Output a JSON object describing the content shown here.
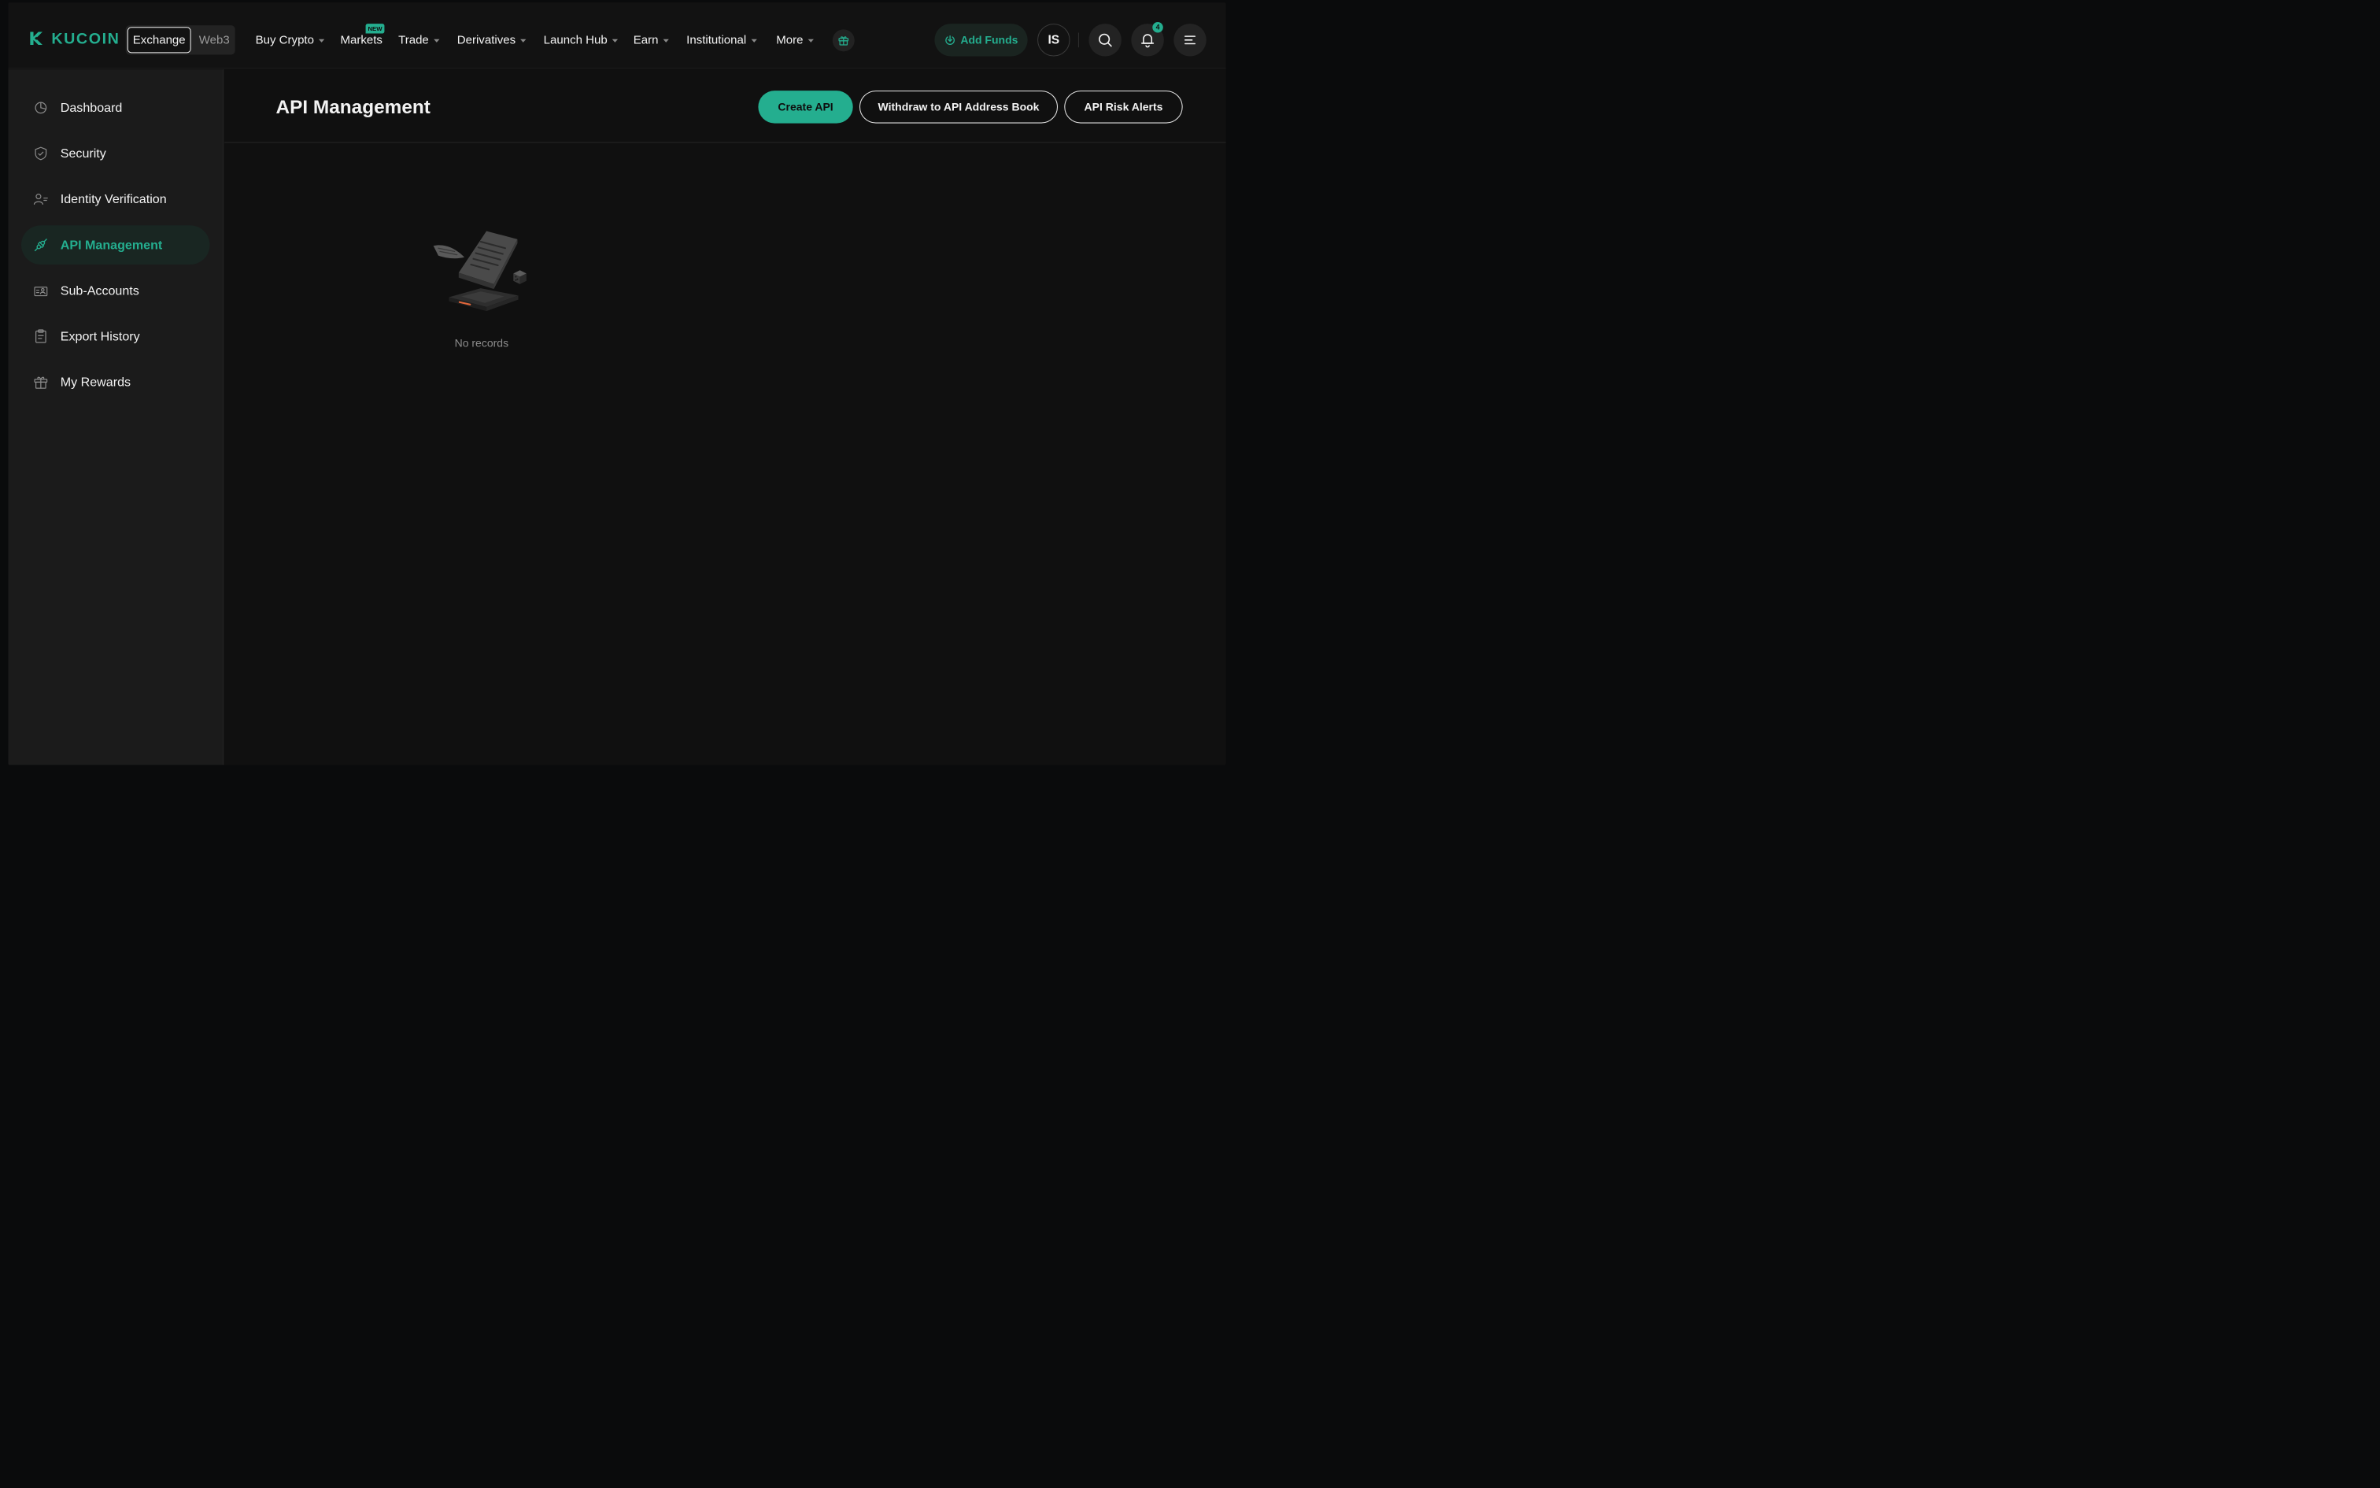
{
  "brand": {
    "logo_text": "KUCOIN"
  },
  "top_nav": {
    "mode_switch": {
      "exchange": "Exchange",
      "web3": "Web3"
    },
    "items": [
      {
        "label": "Buy Crypto",
        "has_dropdown": true
      },
      {
        "label": "Markets",
        "has_dropdown": false,
        "badge": "NEW"
      },
      {
        "label": "Trade",
        "has_dropdown": true
      },
      {
        "label": "Derivatives",
        "has_dropdown": true
      },
      {
        "label": "Launch Hub",
        "has_dropdown": true
      },
      {
        "label": "Earn",
        "has_dropdown": true
      },
      {
        "label": "Institutional",
        "has_dropdown": true
      },
      {
        "label": "More",
        "has_dropdown": true
      }
    ],
    "gift_icon": "gift-icon",
    "add_funds_label": "Add Funds",
    "avatar_initials": "IS",
    "search_icon": "search-icon",
    "bell_icon": "bell-icon",
    "notification_count": "4",
    "menu_icon": "menu-icon"
  },
  "sidebar": {
    "items": [
      {
        "label": "Dashboard",
        "icon": "pie-chart-icon",
        "active": false
      },
      {
        "label": "Security",
        "icon": "shield-check-icon",
        "active": false
      },
      {
        "label": "Identity Verification",
        "icon": "user-id-icon",
        "active": false
      },
      {
        "label": "API Management",
        "icon": "plug-icon",
        "active": true
      },
      {
        "label": "Sub-Accounts",
        "icon": "sub-accounts-icon",
        "active": false
      },
      {
        "label": "Export History",
        "icon": "clipboard-icon",
        "active": false
      },
      {
        "label": "My Rewards",
        "icon": "gift-icon",
        "active": false
      }
    ]
  },
  "main": {
    "title": "API Management",
    "buttons": {
      "create_api": "Create API",
      "withdraw_address_book": "Withdraw to API Address Book",
      "risk_alerts": "API Risk Alerts"
    },
    "empty_state": {
      "text": "No records",
      "illustration": "empty-records-illustration"
    }
  },
  "colors": {
    "accent": "#24ae8f",
    "background": "#101010",
    "sidebar": "#1b1b1b",
    "active_item_bg": "#192622",
    "muted_text": "#8c8c8c"
  }
}
